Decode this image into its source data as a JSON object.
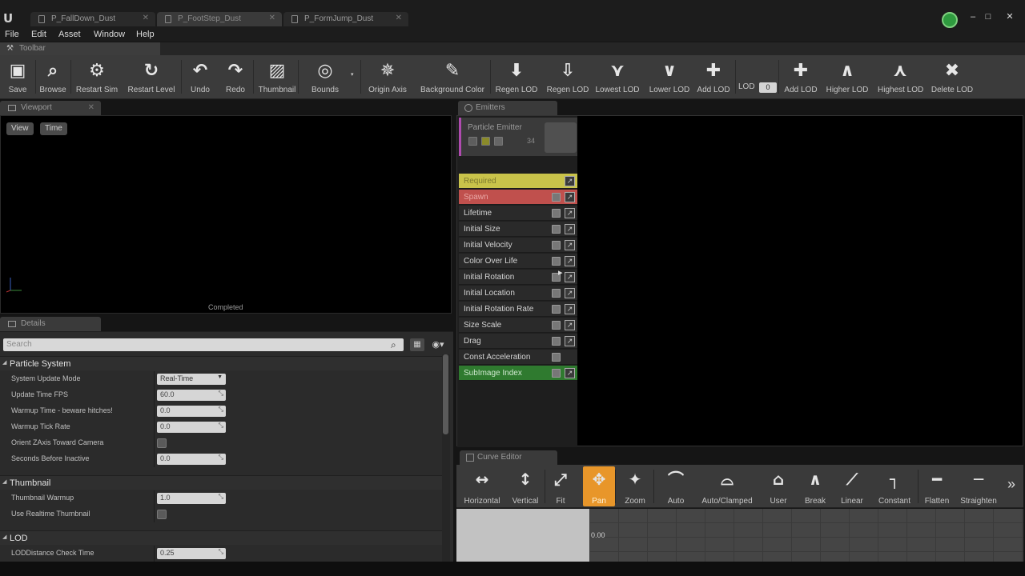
{
  "window": {
    "tabs": [
      {
        "label": "P_FallDown_Dust",
        "active": false
      },
      {
        "label": "P_FootStep_Dust",
        "active": true
      },
      {
        "label": "P_FormJump_Dust",
        "active": false
      }
    ],
    "controls": {
      "minimize": "–",
      "maximize": "□",
      "close": "✕"
    },
    "logo": "U"
  },
  "menu": [
    "File",
    "Edit",
    "Asset",
    "Window",
    "Help"
  ],
  "toolbar": {
    "tab_label": "Toolbar",
    "buttons": [
      {
        "label": "Save",
        "icon": "save-icon",
        "glyph": "▣"
      },
      {
        "label": "Browse",
        "icon": "browse-icon",
        "glyph": "⌕"
      },
      {
        "label": "Restart Sim",
        "icon": "restart-sim-icon",
        "glyph": "⚙"
      },
      {
        "label": "Restart Level",
        "icon": "restart-level-icon",
        "glyph": "↻"
      },
      {
        "label": "Undo",
        "icon": "undo-icon",
        "glyph": "↶"
      },
      {
        "label": "Redo",
        "icon": "redo-icon",
        "glyph": "↷"
      },
      {
        "label": "Thumbnail",
        "icon": "thumbnail-icon",
        "glyph": "▨"
      },
      {
        "label": "Bounds",
        "icon": "bounds-icon",
        "glyph": "◎"
      },
      {
        "label": "Origin Axis",
        "icon": "origin-axis-icon",
        "glyph": "✵"
      },
      {
        "label": "Background Color",
        "icon": "background-color-icon",
        "glyph": "✎"
      },
      {
        "label": "Regen LOD",
        "icon": "regen-lod-icon",
        "glyph": "⬇"
      },
      {
        "label": "Regen LOD",
        "icon": "regen-lod-all-icon",
        "glyph": "⇩"
      },
      {
        "label": "Lowest LOD",
        "icon": "lowest-lod-icon",
        "glyph": "⋎"
      },
      {
        "label": "Lower LOD",
        "icon": "lower-lod-icon",
        "glyph": "∨"
      },
      {
        "label": "Add LOD",
        "icon": "add-lod-icon",
        "glyph": "✚"
      },
      {
        "label": "Add LOD",
        "icon": "add-lod-above-icon",
        "glyph": "✚"
      },
      {
        "label": "Higher LOD",
        "icon": "higher-lod-icon",
        "glyph": "∧"
      },
      {
        "label": "Highest LOD",
        "icon": "highest-lod-icon",
        "glyph": "⋏"
      },
      {
        "label": "Delete LOD",
        "icon": "delete-lod-icon",
        "glyph": "✖"
      }
    ],
    "lod_label": "LOD",
    "lod_value": "0"
  },
  "viewport": {
    "tab_label": "Viewport",
    "buttons": [
      "View",
      "Time"
    ],
    "status": "Completed"
  },
  "details": {
    "tab_label": "Details",
    "search_placeholder": "Search",
    "categories": [
      {
        "title": "Particle System",
        "rows": [
          {
            "name": "System Update Mode",
            "type": "select",
            "value": "Real-Time"
          },
          {
            "name": "Update Time FPS",
            "type": "number",
            "value": "60.0"
          },
          {
            "name": "Warmup Time - beware hitches!",
            "type": "number",
            "value": "0.0"
          },
          {
            "name": "Warmup Tick Rate",
            "type": "number",
            "value": "0.0"
          },
          {
            "name": "Orient ZAxis Toward Camera",
            "type": "check",
            "value": ""
          },
          {
            "name": "Seconds Before Inactive",
            "type": "number",
            "value": "0.0"
          }
        ]
      },
      {
        "title": "Thumbnail",
        "rows": [
          {
            "name": "Thumbnail Warmup",
            "type": "number",
            "value": "1.0"
          },
          {
            "name": "Use Realtime Thumbnail",
            "type": "check",
            "value": ""
          }
        ]
      },
      {
        "title": "LOD",
        "rows": [
          {
            "name": "LODDistance Check Time",
            "type": "number",
            "value": "0.25"
          }
        ]
      }
    ]
  },
  "emitters": {
    "tab_label": "Emitters",
    "emitter_name": "Particle Emitter",
    "emitter_count": "34",
    "modules": [
      {
        "name": "Required",
        "style": "required",
        "enable": false,
        "curve": true
      },
      {
        "name": "Spawn",
        "style": "spawn",
        "enable": true,
        "curve": true
      },
      {
        "name": "Lifetime",
        "style": "",
        "enable": true,
        "curve": true
      },
      {
        "name": "Initial Size",
        "style": "",
        "enable": true,
        "curve": true
      },
      {
        "name": "Initial Velocity",
        "style": "",
        "enable": true,
        "curve": true
      },
      {
        "name": "Color Over Life",
        "style": "",
        "enable": true,
        "curve": true
      },
      {
        "name": "Initial Rotation",
        "style": "",
        "enable": true,
        "curve": true
      },
      {
        "name": "Initial Location",
        "style": "",
        "enable": true,
        "curve": true
      },
      {
        "name": "Initial Rotation Rate",
        "style": "",
        "enable": true,
        "curve": true
      },
      {
        "name": "Size Scale",
        "style": "",
        "enable": true,
        "curve": true
      },
      {
        "name": "Drag",
        "style": "",
        "enable": true,
        "curve": true
      },
      {
        "name": "Const Acceleration",
        "style": "",
        "enable": true,
        "curve": false
      },
      {
        "name": "SubImage Index",
        "style": "subimage",
        "enable": true,
        "curve": true
      }
    ],
    "colors": {
      "required": "#c9c34a",
      "spawn": "#c0504d",
      "subimage": "#2f7a2f"
    }
  },
  "curve_editor": {
    "tab_label": "Curve Editor",
    "buttons": [
      {
        "label": "Horizontal",
        "icon": "fit-horizontal-icon",
        "glyph": "↔",
        "active": false
      },
      {
        "label": "Vertical",
        "icon": "fit-vertical-icon",
        "glyph": "↕",
        "active": false
      },
      {
        "label": "Fit",
        "icon": "fit-icon",
        "glyph": "⤢",
        "active": false
      },
      {
        "label": "Pan",
        "icon": "pan-icon",
        "glyph": "✥",
        "active": true
      },
      {
        "label": "Zoom",
        "icon": "zoom-icon",
        "glyph": "✦",
        "active": false
      },
      {
        "label": "Auto",
        "icon": "auto-tangent-icon",
        "glyph": "⌒",
        "active": false
      },
      {
        "label": "Auto/Clamped",
        "icon": "auto-clamped-icon",
        "glyph": "⌓",
        "active": false
      },
      {
        "label": "User",
        "icon": "user-tangent-icon",
        "glyph": "⌂",
        "active": false
      },
      {
        "label": "Break",
        "icon": "break-tangent-icon",
        "glyph": "∧",
        "active": false
      },
      {
        "label": "Linear",
        "icon": "linear-icon",
        "glyph": "⟋",
        "active": false
      },
      {
        "label": "Constant",
        "icon": "constant-icon",
        "glyph": "┐",
        "active": false
      },
      {
        "label": "Flatten",
        "icon": "flatten-icon",
        "glyph": "━",
        "active": false
      },
      {
        "label": "Straighten",
        "icon": "straighten-icon",
        "glyph": "─",
        "active": false
      }
    ],
    "more_glyph": "»",
    "graph_zero": "0.00"
  }
}
